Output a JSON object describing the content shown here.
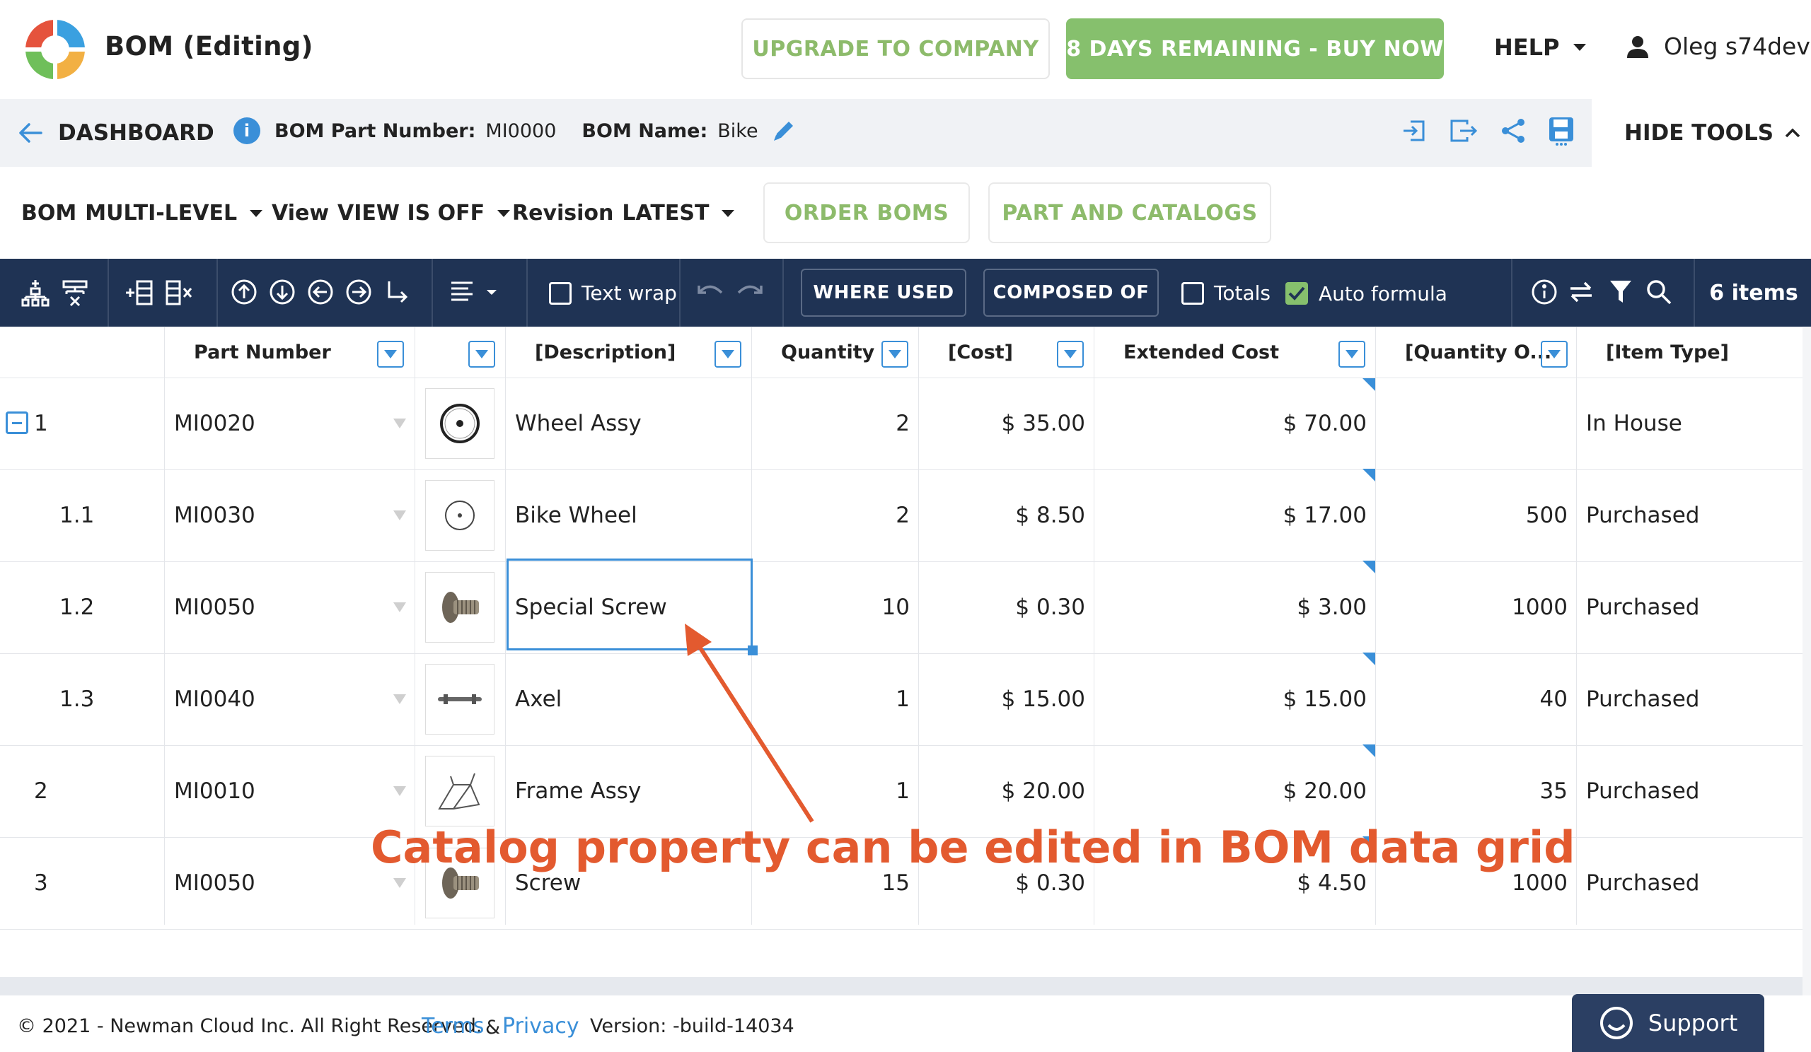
{
  "header": {
    "title": "BOM (Editing)",
    "upgrade_label": "UPGRADE TO COMPANY",
    "buy_label": "8 DAYS REMAINING - BUY NOW",
    "help_label": "HELP",
    "user_name": "Oleg s74dev"
  },
  "subheader": {
    "dashboard_label": "DASHBOARD",
    "part_number_label": "BOM Part Number:",
    "part_number_value": "MI0000",
    "bom_name_label": "BOM Name:",
    "bom_name_value": "Bike",
    "hide_tools_label": "HIDE TOOLS"
  },
  "selectors": {
    "bom_label": "BOM",
    "bom_value": "MULTI-LEVEL",
    "view_label": "View",
    "view_value": "VIEW IS OFF",
    "revision_label": "Revision",
    "revision_value": "LATEST",
    "order_boms_label": "ORDER BOMS",
    "part_catalogs_label": "PART AND CATALOGS"
  },
  "toolbar": {
    "text_wrap_label": "Text wrap",
    "text_wrap_checked": false,
    "where_used_label": "WHERE USED",
    "composed_of_label": "COMPOSED OF",
    "totals_label": "Totals",
    "totals_checked": false,
    "auto_formula_label": "Auto formula",
    "auto_formula_checked": true,
    "items_count": "6 items"
  },
  "grid": {
    "columns": [
      "Part Number",
      "[Description]",
      "Quantity",
      "[Cost]",
      "Extended Cost",
      "[Quantity O...",
      "[Item Type]"
    ],
    "rows": [
      {
        "level": "1",
        "part": "MI0020",
        "desc": "Wheel Assy",
        "qty": "2",
        "cost": "$ 35.00",
        "ext": "$ 70.00",
        "qo": "",
        "type": "In House"
      },
      {
        "level": "1.1",
        "part": "MI0030",
        "desc": "Bike Wheel",
        "qty": "2",
        "cost": "$ 8.50",
        "ext": "$ 17.00",
        "qo": "500",
        "type": "Purchased"
      },
      {
        "level": "1.2",
        "part": "MI0050",
        "desc": "Special Screw",
        "qty": "10",
        "cost": "$ 0.30",
        "ext": "$ 3.00",
        "qo": "1000",
        "type": "Purchased"
      },
      {
        "level": "1.3",
        "part": "MI0040",
        "desc": "Axel",
        "qty": "1",
        "cost": "$ 15.00",
        "ext": "$ 15.00",
        "qo": "40",
        "type": "Purchased"
      },
      {
        "level": "2",
        "part": "MI0010",
        "desc": "Frame Assy",
        "qty": "1",
        "cost": "$ 20.00",
        "ext": "$ 20.00",
        "qo": "35",
        "type": "Purchased"
      },
      {
        "level": "3",
        "part": "MI0050",
        "desc": "Screw",
        "qty": "15",
        "cost": "$ 0.30",
        "ext": "$ 4.50",
        "qo": "1000",
        "type": "Purchased"
      }
    ]
  },
  "annotation": "Catalog property can be edited in BOM data grid",
  "footer": {
    "copyright": "© 2021 - Newman Cloud Inc. All Right Reserved.",
    "terms": "Terms",
    "amp": "&",
    "privacy": "Privacy",
    "version": "Version: -build-14034",
    "support_label": "Support"
  },
  "colors": {
    "navy": "#1f3354",
    "green": "#86c06d",
    "blue": "#3a8fd8",
    "annotation_red": "#e35a2f"
  }
}
